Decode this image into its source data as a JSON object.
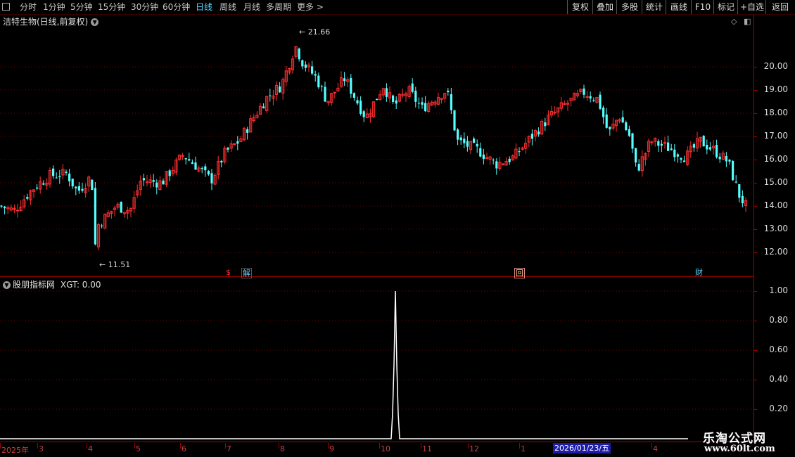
{
  "toolbar": {
    "periods": [
      "分时",
      "1分钟",
      "5分钟",
      "15分钟",
      "30分钟",
      "60分钟",
      "日线",
      "周线",
      "月线",
      "多周期",
      "更多 >"
    ],
    "active_period": "日线",
    "buttons": [
      "复权",
      "叠加",
      "多股",
      "统计",
      "画线",
      "F10",
      "标记",
      "+自选",
      "返回"
    ]
  },
  "main_chart": {
    "title": "洁特生物(日线,前复权)",
    "y_ticks": [
      "20.00",
      "19.00",
      "18.00",
      "17.00",
      "16.00",
      "15.00",
      "14.00",
      "13.00",
      "12.00"
    ],
    "high_label": "21.66",
    "low_label": "11.51",
    "markers": [
      {
        "text": "$",
        "color": "#ff3030"
      },
      {
        "text": "解",
        "color": "#59d3ff"
      },
      {
        "text": "回",
        "color": "#ffd080"
      },
      {
        "text": "财",
        "color": "#59d3ff"
      }
    ],
    "up_color": "#ff3030",
    "down_color": "#54ffff"
  },
  "sub_chart": {
    "title": "股朋指标网",
    "indicator": "XGT: 0.00",
    "y_ticks": [
      "1.00",
      "0.80",
      "0.60",
      "0.40",
      "0.20"
    ]
  },
  "x_axis": {
    "labels": [
      "2025年",
      "3",
      "4",
      "5",
      "6",
      "7",
      "8",
      "9",
      "10",
      "11",
      "12",
      "1",
      "4"
    ],
    "highlighted_date": "2026/01/23/五"
  },
  "watermark": {
    "line1": "乐淘公式网",
    "line2": "www.60lt.com"
  },
  "chart_data": {
    "type": "candlestick",
    "ylim": [
      11.0,
      22.4
    ],
    "high": 21.66,
    "low": 11.51,
    "indicator_signal": {
      "name": "XGT",
      "peak": 1.0,
      "month": "10"
    }
  }
}
